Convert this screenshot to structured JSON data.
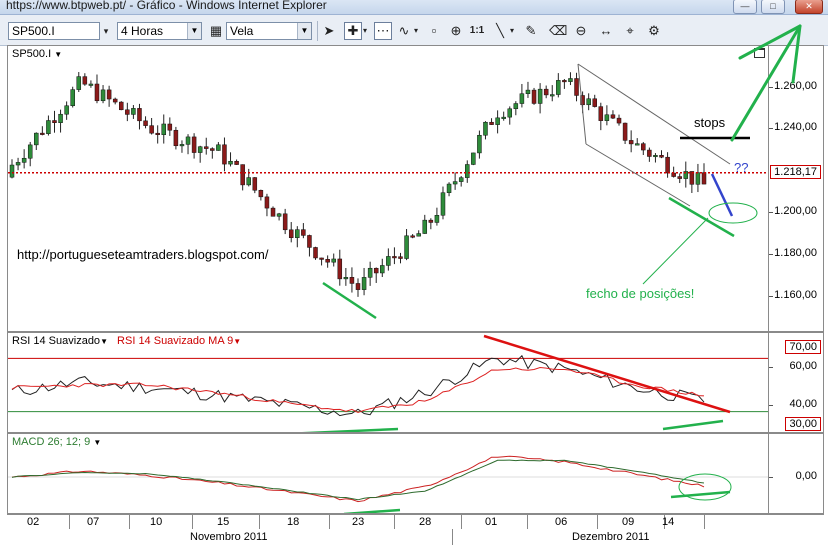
{
  "window": {
    "title": "https://www.btpweb.pt/ - Gráfico - Windows Internet Explorer",
    "min_icon": "minimize-icon",
    "max_icon": "maximize-icon",
    "close_icon": "close-icon"
  },
  "toolbar": {
    "symbol": "SP500.I",
    "timeframe": "4 Horas",
    "chart_type": "Vela",
    "ratio_label": "1:1"
  },
  "price_panel": {
    "label": "SP500.I",
    "current_price": "1.218,17",
    "ticks": [
      "1.260,00",
      "1.240,00",
      "1.200,00",
      "1.180,00",
      "1.160,00"
    ],
    "annotations": {
      "url": "http://portugueseteamtraders.blogspot.com/",
      "stops": "stops",
      "question": "??",
      "exit": "fecho de posições!"
    }
  },
  "rsi_panel": {
    "label": "RSI 14 Suavizado",
    "ma_label": "RSI 14 Suavizado MA 9",
    "level_high": "70,00",
    "level_low": "30,00",
    "ticks": [
      "60,00",
      "40,00"
    ]
  },
  "macd_panel": {
    "label": "MACD 26; 12; 9",
    "ticks": [
      "0,00"
    ]
  },
  "time_axis": {
    "days": [
      "02",
      "07",
      "10",
      "15",
      "18",
      "23",
      "28",
      "01",
      "06",
      "09",
      "14"
    ],
    "months": [
      "Novembro 2011",
      "Dezembro 2011"
    ]
  },
  "colors": {
    "up_candle": "#2e8b3a",
    "down_candle": "#8b1a1a",
    "price_line": "#cc0000",
    "annotation_green": "#22b14c",
    "annotation_blue": "#3344cc",
    "trend_red": "#dd1111"
  },
  "chart_data": [
    {
      "type": "candlestick",
      "title": "SP500.I",
      "ylim": [
        1145,
        1275
      ],
      "x": [
        "02",
        "07",
        "10",
        "15",
        "18",
        "23",
        "28",
        "01",
        "06",
        "09",
        "14"
      ],
      "close_approx": [
        1222,
        1262,
        1240,
        1228,
        1192,
        1162,
        1192,
        1248,
        1262,
        1232,
        1212
      ],
      "current_price": 1218.17
    },
    {
      "type": "line",
      "title": "RSI 14 Suavizado",
      "ylim": [
        20,
        80
      ],
      "levels": [
        70,
        30
      ],
      "series": [
        {
          "name": "RSI 14 Suavizado",
          "values": [
            45,
            52,
            48,
            42,
            35,
            28,
            45,
            70,
            62,
            48,
            38
          ]
        },
        {
          "name": "RSI 14 Suavizado MA 9",
          "values": [
            48,
            50,
            50,
            44,
            36,
            30,
            38,
            62,
            62,
            50,
            42
          ]
        }
      ]
    },
    {
      "type": "line",
      "title": "MACD 26; 12; 9",
      "ylim": [
        -1,
        1
      ],
      "series": [
        {
          "values": [
            0.0,
            0.2,
            0.05,
            -0.2,
            -0.5,
            -0.8,
            -0.3,
            0.7,
            0.5,
            0.1,
            -0.3
          ]
        },
        {
          "values": [
            0.0,
            0.15,
            0.1,
            -0.15,
            -0.45,
            -0.75,
            -0.45,
            0.55,
            0.55,
            0.2,
            -0.2
          ]
        }
      ]
    }
  ]
}
